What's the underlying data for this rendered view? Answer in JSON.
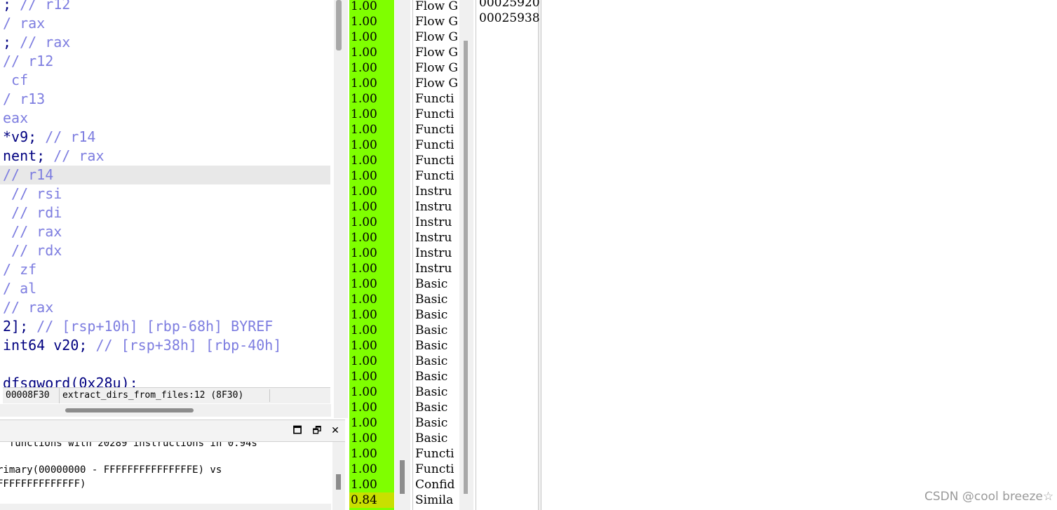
{
  "code": {
    "lines": [
      [
        {
          "t": "; ",
          "c": "dark"
        },
        {
          "t": "// r12",
          "c": "comment"
        }
      ],
      [
        {
          "t": "/ rax",
          "c": "comment"
        }
      ],
      [
        {
          "t": "; ",
          "c": "dark"
        },
        {
          "t": "// rax",
          "c": "comment"
        }
      ],
      [
        {
          "t": "// r12",
          "c": "comment"
        }
      ],
      [
        {
          "t": " cf",
          "c": "comment"
        }
      ],
      [
        {
          "t": "/ r13",
          "c": "comment"
        }
      ],
      [
        {
          "t": "eax",
          "c": "comment"
        }
      ],
      [
        {
          "t": "*v9; ",
          "c": "dark"
        },
        {
          "t": "// r14",
          "c": "comment"
        }
      ],
      [
        {
          "t": "nent; ",
          "c": "dark"
        },
        {
          "t": "// rax",
          "c": "comment"
        }
      ],
      [
        {
          "t": "// r14",
          "c": "comment"
        }
      ],
      [
        {
          "t": " // rsi",
          "c": "comment"
        }
      ],
      [
        {
          "t": " // rdi",
          "c": "comment"
        }
      ],
      [
        {
          "t": " // rax",
          "c": "comment"
        }
      ],
      [
        {
          "t": " // rdx",
          "c": "comment"
        }
      ],
      [
        {
          "t": "/ zf",
          "c": "comment"
        }
      ],
      [
        {
          "t": "/ al",
          "c": "comment"
        }
      ],
      [
        {
          "t": "// rax",
          "c": "comment"
        }
      ],
      [
        {
          "t": "2]; ",
          "c": "dark"
        },
        {
          "t": "// [rsp+10h] [rbp-68h] BYREF",
          "c": "comment"
        }
      ],
      [
        {
          "t": "int64 v20; ",
          "c": "dark"
        },
        {
          "t": "// [rsp+38h] [rbp-40h]",
          "c": "comment"
        }
      ],
      [],
      [
        {
          "t": "dfsqword(0x28u);",
          "c": "dark"
        }
      ]
    ],
    "highlight_index": 9
  },
  "status": {
    "address": "00008F30",
    "location": "extract_dirs_from_files:12 (8F30)"
  },
  "output": {
    "controls": {
      "maximize": "🗖",
      "restore": "🗗",
      "close": "✕"
    },
    "lines": [
      "  functions with 20289 instructions in 0.94s",
      "",
      "rimary(00000000 - FFFFFFFFFFFFFFFE) vs",
      "FFFFFFFFFFFFFF)"
    ]
  },
  "table": {
    "similarity": [
      "1.00",
      "1.00",
      "1.00",
      "1.00",
      "1.00",
      "1.00",
      "1.00",
      "1.00",
      "1.00",
      "1.00",
      "1.00",
      "1.00",
      "1.00",
      "1.00",
      "1.00",
      "1.00",
      "1.00",
      "1.00",
      "1.00",
      "1.00",
      "1.00",
      "1.00",
      "1.00",
      "1.00",
      "1.00",
      "1.00",
      "1.00",
      "1.00",
      "1.00",
      "1.00",
      "1.00",
      "1.00",
      "0.84"
    ],
    "description": [
      "Flow G",
      "Flow G",
      "Flow G",
      "Flow G",
      "Flow G",
      "Flow G",
      "Functi",
      "Functi",
      "Functi",
      "Functi",
      "Functi",
      "Functi",
      "Instru",
      "Instru",
      "Instru",
      "Instru",
      "Instru",
      "Instru",
      "Basic ",
      "Basic ",
      "Basic ",
      "Basic ",
      "Basic ",
      "Basic ",
      "Basic ",
      "Basic ",
      "Basic ",
      "Basic ",
      "Basic ",
      "Functi",
      "Functi",
      "Confid",
      "Simila"
    ],
    "addresses": [
      "00025920",
      "00025938"
    ]
  },
  "colors": {
    "similarity_high": "#7fff00",
    "similarity_low": "#c8e000"
  },
  "watermark": "CSDN @cool breeze☆"
}
